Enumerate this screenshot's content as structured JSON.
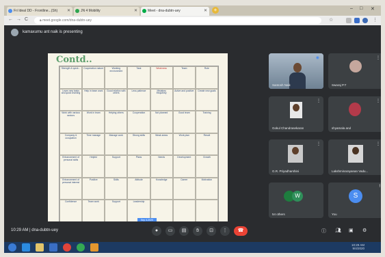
{
  "browser": {
    "tabs": [
      {
        "label": "Fri Ideal DD - Frontline...(Sh)",
        "active": false
      },
      {
        "label": "JN 4 Mobility",
        "active": false
      },
      {
        "label": "Meet - dna-dubtn-uey",
        "active": true
      }
    ],
    "new_tab": "+",
    "url": "meet.google.com/dna-dubtn-uey"
  },
  "meeting": {
    "presenting_text": "kamaxumu ant naik is presenting",
    "meeting_time": "10:29 AM",
    "meeting_code": "dna-dubtn-uey"
  },
  "slide": {
    "title": "Contd..",
    "footer_label": "Sep 4-2020",
    "headers": [
      "Strength & quick...",
      "Cooperation nature",
      "Working environment",
      "Task",
      "Weakness",
      "Team",
      "Role"
    ],
    "rows": [
      [
        "Learn new tasks and quick learning",
        "Help in team work",
        "Good relation with others",
        "Less patience",
        "Mistakes frequently",
        "Active and positive",
        "Create new goals"
      ],
      [
        "Work with various sectors",
        "Work in team",
        "Helping others",
        "Cooperation",
        "Not planned",
        "Good team",
        "Training"
      ],
      [
        "Company & occupation",
        "Time manage",
        "Manage work",
        "Strong skills",
        "Weak areas",
        "Work plan",
        "Result"
      ],
      [
        "Enhancement of personal skills",
        "Helpful",
        "Support",
        "Plans",
        "Needs",
        "Development",
        "Growth"
      ],
      [
        "Enhancement of personal interest",
        "Positive",
        "Skills",
        "Attitude",
        "Knowledge",
        "Career",
        "Motivation"
      ],
      [
        "Confidence",
        "Team work",
        "Support",
        "Leadership",
        "",
        "",
        ""
      ]
    ]
  },
  "participants": [
    {
      "name": "Santosh Naik",
      "type": "video"
    },
    {
      "name": "Swaraj P.T",
      "type": "photo"
    },
    {
      "name": "Gokul Chandrasekaran",
      "type": "photo"
    },
    {
      "name": "shyamala arul",
      "type": "photo"
    },
    {
      "name": "G.R. Priyadharshini",
      "type": "photo"
    },
    {
      "name": "Lakshminarayanan Vadu...",
      "type": "photo"
    },
    {
      "name": "54 others",
      "type": "initial",
      "initial": "W"
    },
    {
      "name": "You",
      "type": "initial",
      "initial": "S"
    }
  ],
  "taskbar": {
    "clock_time": "10:29 AM",
    "clock_date": "9/4/2020"
  },
  "colors": {
    "accent": "#4b8df0",
    "end_call": "#ea4335",
    "meet_bg": "#2a2c2f"
  }
}
